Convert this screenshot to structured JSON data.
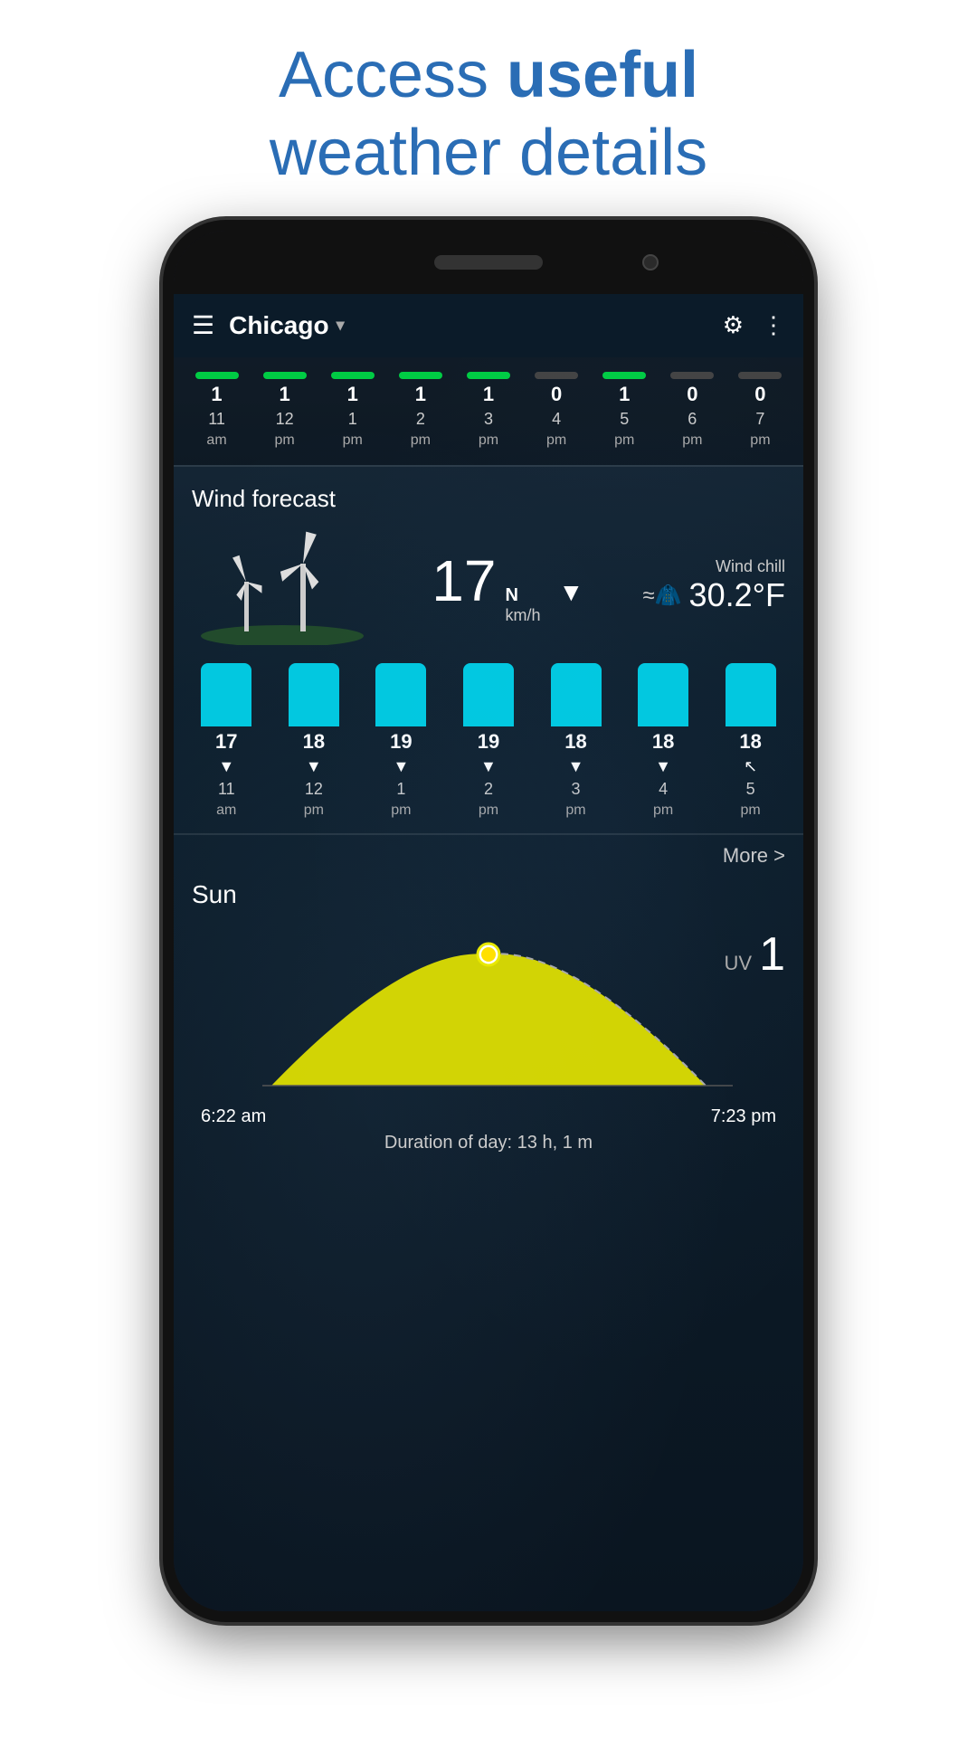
{
  "header": {
    "line1": "Access ",
    "line1_bold": "useful",
    "line2": "weather details"
  },
  "toolbar": {
    "menu_icon": "☰",
    "city": "Chicago",
    "dropdown_arrow": "▾",
    "gear_icon": "⚙",
    "dots_icon": "⋮"
  },
  "precip_section": {
    "items": [
      {
        "bar": "active",
        "value": "1",
        "time_main": "11",
        "time_sub": "am"
      },
      {
        "bar": "active",
        "value": "1",
        "time_main": "12",
        "time_sub": "pm"
      },
      {
        "bar": "active",
        "value": "1",
        "time_main": "1",
        "time_sub": "pm"
      },
      {
        "bar": "active",
        "value": "1",
        "time_main": "2",
        "time_sub": "pm"
      },
      {
        "bar": "active",
        "value": "1",
        "time_main": "3",
        "time_sub": "pm"
      },
      {
        "bar": "inactive",
        "value": "0",
        "time_main": "4",
        "time_sub": "pm"
      },
      {
        "bar": "active",
        "value": "1",
        "time_main": "5",
        "time_sub": "pm"
      },
      {
        "bar": "inactive",
        "value": "0",
        "time_main": "6",
        "time_sub": "pm"
      },
      {
        "bar": "inactive",
        "value": "0",
        "time_main": "7",
        "time_sub": "pm"
      }
    ]
  },
  "wind_section": {
    "title": "Wind forecast",
    "speed": "17",
    "unit": "km/h",
    "direction": "N",
    "arrow": "▼",
    "chill_label": "Wind chill",
    "chill_icon": "≈👕",
    "chill_temp": "30.2°F",
    "bars": [
      {
        "speed": "17",
        "arrow": "▼",
        "time_main": "11",
        "time_sub": "am"
      },
      {
        "speed": "18",
        "arrow": "▼",
        "time_main": "12",
        "time_sub": "pm"
      },
      {
        "speed": "19",
        "arrow": "▼",
        "time_main": "1",
        "time_sub": "pm"
      },
      {
        "speed": "19",
        "arrow": "▼",
        "time_main": "2",
        "time_sub": "pm"
      },
      {
        "speed": "18",
        "arrow": "▼",
        "time_main": "3",
        "time_sub": "pm"
      },
      {
        "speed": "18",
        "arrow": "▼",
        "time_main": "4",
        "time_sub": "pm"
      },
      {
        "speed": "18",
        "arrow": "↖",
        "time_main": "5",
        "time_sub": "pm"
      }
    ]
  },
  "more_link": "More >",
  "sun_section": {
    "title": "Sun",
    "uv_label": "UV",
    "uv_value": "1",
    "sunrise": "6:22 am",
    "sunset": "7:23 pm",
    "duration": "Duration of day: 13 h, 1 m"
  }
}
